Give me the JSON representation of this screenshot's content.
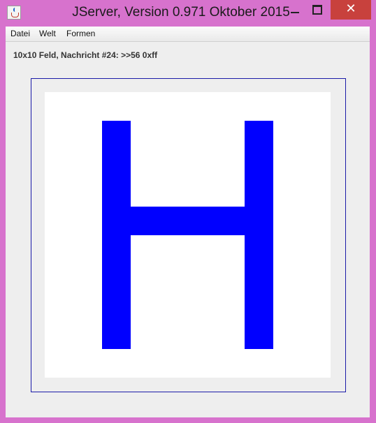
{
  "window": {
    "title": "JServer, Version 0.971 Oktober 2015",
    "icon": "java-cup-icon",
    "controls": {
      "minimize": "minimize-icon",
      "maximize": "maximize-icon",
      "close": "close-icon",
      "close_glyph": "✕"
    },
    "colors": {
      "frame": "#d772cd",
      "close_button": "#c8413d"
    }
  },
  "menu": {
    "items": [
      {
        "label": "Datei"
      },
      {
        "label": "Welt"
      },
      {
        "label": "Formen"
      }
    ]
  },
  "status": {
    "text": "10x10 Feld, Nachricht #24: >>56 0xff"
  },
  "board": {
    "rows": 10,
    "cols": 10,
    "fill_color": "#0000ff",
    "background_color": "#ffffff",
    "border_color": "#1a1aa8",
    "filled_cells": [
      [
        1,
        2
      ],
      [
        1,
        7
      ],
      [
        2,
        2
      ],
      [
        2,
        7
      ],
      [
        3,
        2
      ],
      [
        3,
        7
      ],
      [
        4,
        2
      ],
      [
        4,
        3
      ],
      [
        4,
        4
      ],
      [
        4,
        5
      ],
      [
        4,
        6
      ],
      [
        4,
        7
      ],
      [
        5,
        2
      ],
      [
        5,
        7
      ],
      [
        6,
        2
      ],
      [
        6,
        7
      ],
      [
        7,
        2
      ],
      [
        7,
        7
      ],
      [
        8,
        2
      ],
      [
        8,
        7
      ]
    ]
  }
}
